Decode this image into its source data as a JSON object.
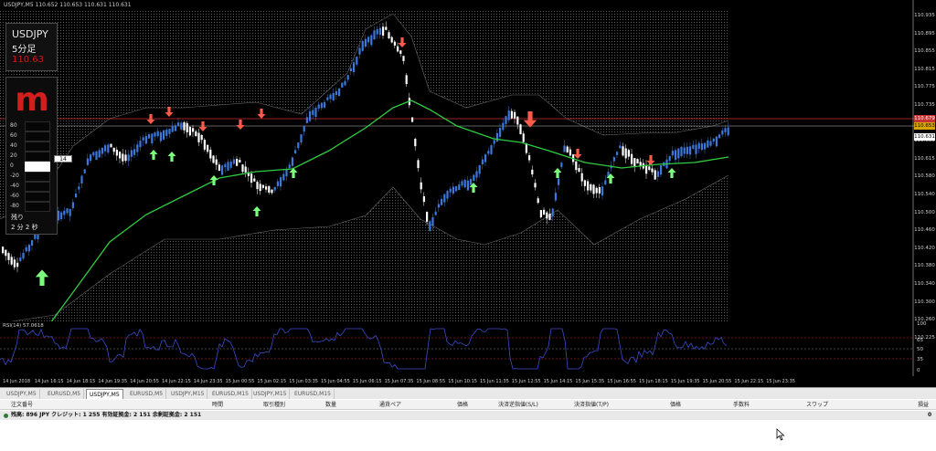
{
  "window": {
    "title": "USDJPY,M5  110.652  110.653  110.631  110.631"
  },
  "symbol_box": {
    "symbol": "USDJPY",
    "timeframe": "5分足",
    "price": "110.63",
    "price_color": "#d01818"
  },
  "indicator_box": {
    "logo_letter": "m",
    "logo_color": "#d41e1e",
    "levels": [
      "80",
      "60",
      "40",
      "20",
      "0",
      "-20",
      "-40",
      "-60",
      "-80"
    ],
    "current_value": "14",
    "remaining_label": "残り",
    "remaining_time": "2 分 2 秒"
  },
  "price_axis": {
    "labels": [
      "110.935",
      "110.895",
      "110.855",
      "110.815",
      "110.775",
      "110.735",
      "110.695",
      "110.655",
      "110.615",
      "110.580",
      "110.540",
      "110.500",
      "110.460",
      "110.420",
      "110.380",
      "110.340",
      "110.300",
      "110.260",
      "110.225"
    ],
    "upper_level": "110.679",
    "ask_level": "110.653",
    "bid_level": "110.631"
  },
  "rsi": {
    "title": "RSI(14) 57.0618",
    "labels": [
      "100",
      "65",
      "50",
      "35",
      "0"
    ]
  },
  "time_axis": {
    "labels": [
      "14 Jun 2018",
      "14 Jun 16:15",
      "14 Jun 18:15",
      "14 Jun 19:35",
      "14 Jun 20:55",
      "14 Jun 22:15",
      "14 Jun 23:35",
      "15 Jun 00:55",
      "15 Jun 02:15",
      "15 Jun 03:35",
      "15 Jun 04:55",
      "15 Jun 06:15",
      "15 Jun 07:35",
      "15 Jun 08:55",
      "15 Jun 10:15",
      "15 Jun 11:35",
      "15 Jun 12:55",
      "15 Jun 14:15",
      "15 Jun 15:35",
      "15 Jun 16:55",
      "15 Jun 18:15",
      "15 Jun 19:35",
      "15 Jun 20:55",
      "15 Jun 22:15",
      "15 Jun 23:35"
    ]
  },
  "tabs": [
    {
      "label": "USDJPY,M5",
      "active": false
    },
    {
      "label": "EURUSD,M5",
      "active": false
    },
    {
      "label": "USDJPY,M5",
      "active": true
    },
    {
      "label": "EURUSD,M5",
      "active": false
    },
    {
      "label": "USDJPY,M15",
      "active": false
    },
    {
      "label": "EURUSD,M15",
      "active": false
    },
    {
      "label": "USDJPY,M15",
      "active": false
    },
    {
      "label": "EURUSD,M15",
      "active": false
    }
  ],
  "terminal": {
    "columns": [
      "注文番号",
      "時間",
      "取引種別",
      "数量",
      "通貨ペア",
      "価格",
      "決済逆指値(S/L)",
      "決済指値(T/P)",
      "価格",
      "手数料",
      "スワップ",
      "損益"
    ],
    "balance_text": "残高: 896  JPY  クレジット: 1 255  有効証拠金: 2 151  余剰証拠金: 2 151",
    "total": "0"
  },
  "colors": {
    "candle_up": "#3d78d8",
    "candle_down": "#ffffff",
    "ma_line": "#2ecc40",
    "rsi_line": "#3a4cc8",
    "buy_arrow": "#7cff7c",
    "sell_arrow": "#ff5a4a",
    "level_line": "#c83232"
  }
}
